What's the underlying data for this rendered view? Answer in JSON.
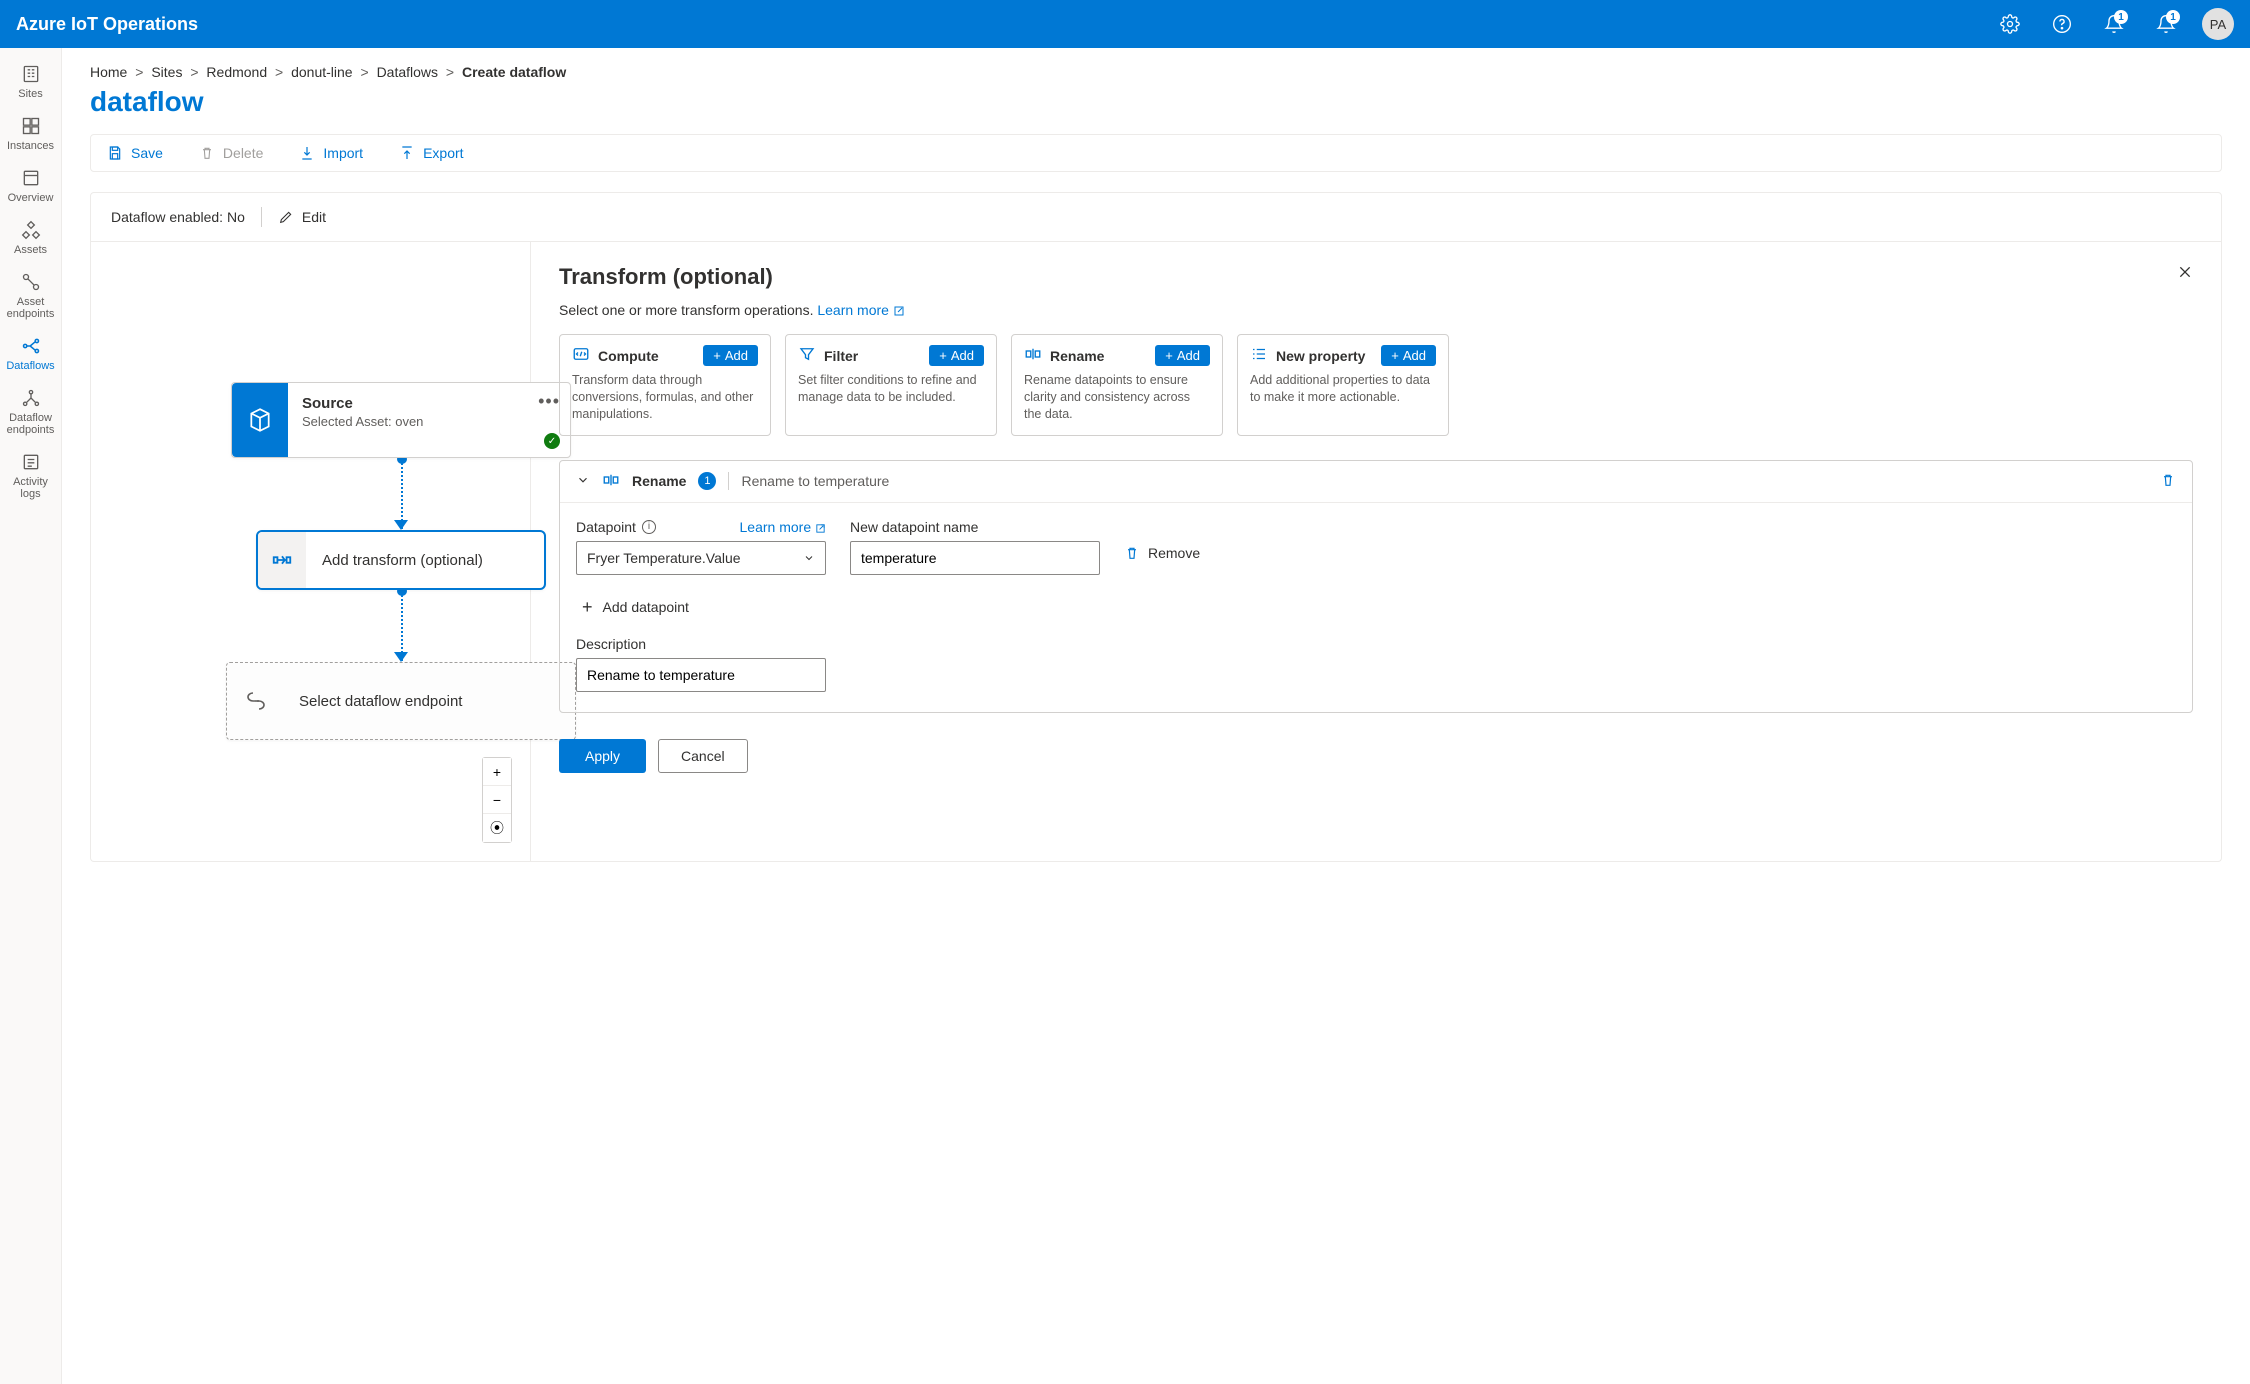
{
  "header": {
    "brand": "Azure IoT Operations",
    "badge1": "1",
    "badge2": "1",
    "avatar_initials": "PA"
  },
  "rail": {
    "items": [
      {
        "label": "Sites"
      },
      {
        "label": "Instances"
      },
      {
        "label": "Overview"
      },
      {
        "label": "Assets"
      },
      {
        "label": "Asset endpoints"
      },
      {
        "label": "Dataflows"
      },
      {
        "label": "Dataflow endpoints"
      },
      {
        "label": "Activity logs"
      }
    ]
  },
  "breadcrumb": {
    "items": [
      "Home",
      "Sites",
      "Redmond",
      "donut-line",
      "Dataflows"
    ],
    "current": "Create dataflow"
  },
  "page_title": "dataflow",
  "toolbar": {
    "save": "Save",
    "delete": "Delete",
    "import": "Import",
    "export": "Export"
  },
  "status": {
    "enabled_label": "Dataflow enabled: No",
    "edit": "Edit"
  },
  "canvas": {
    "source": {
      "title": "Source",
      "subtitle": "Selected Asset: oven"
    },
    "transform": {
      "title": "Add transform (optional)"
    },
    "endpoint": {
      "title": "Select dataflow endpoint"
    }
  },
  "panel": {
    "title": "Transform (optional)",
    "subtitle": "Select one or more transform operations. ",
    "learn_more": "Learn more",
    "cards": {
      "compute": {
        "title": "Compute",
        "add": "Add",
        "desc": "Transform data through conversions, formulas, and other manipulations."
      },
      "filter": {
        "title": "Filter",
        "add": "Add",
        "desc": "Set filter conditions to refine and manage data to be included."
      },
      "rename": {
        "title": "Rename",
        "add": "Add",
        "desc": "Rename datapoints to ensure clarity and consistency across the data."
      },
      "newprop": {
        "title": "New property",
        "add": "Add",
        "desc": "Add additional properties to data to make it more actionable."
      }
    },
    "section": {
      "title": "Rename",
      "count": "1",
      "subtitle": "Rename to temperature",
      "datapoint_label": "Datapoint",
      "learn_more": "Learn more",
      "datapoint_value": "Fryer Temperature.Value",
      "newname_label": "New datapoint name",
      "newname_value": "temperature",
      "remove": "Remove",
      "add_datapoint": "Add datapoint",
      "desc_label": "Description",
      "desc_value": "Rename to temperature"
    },
    "apply": "Apply",
    "cancel": "Cancel"
  }
}
